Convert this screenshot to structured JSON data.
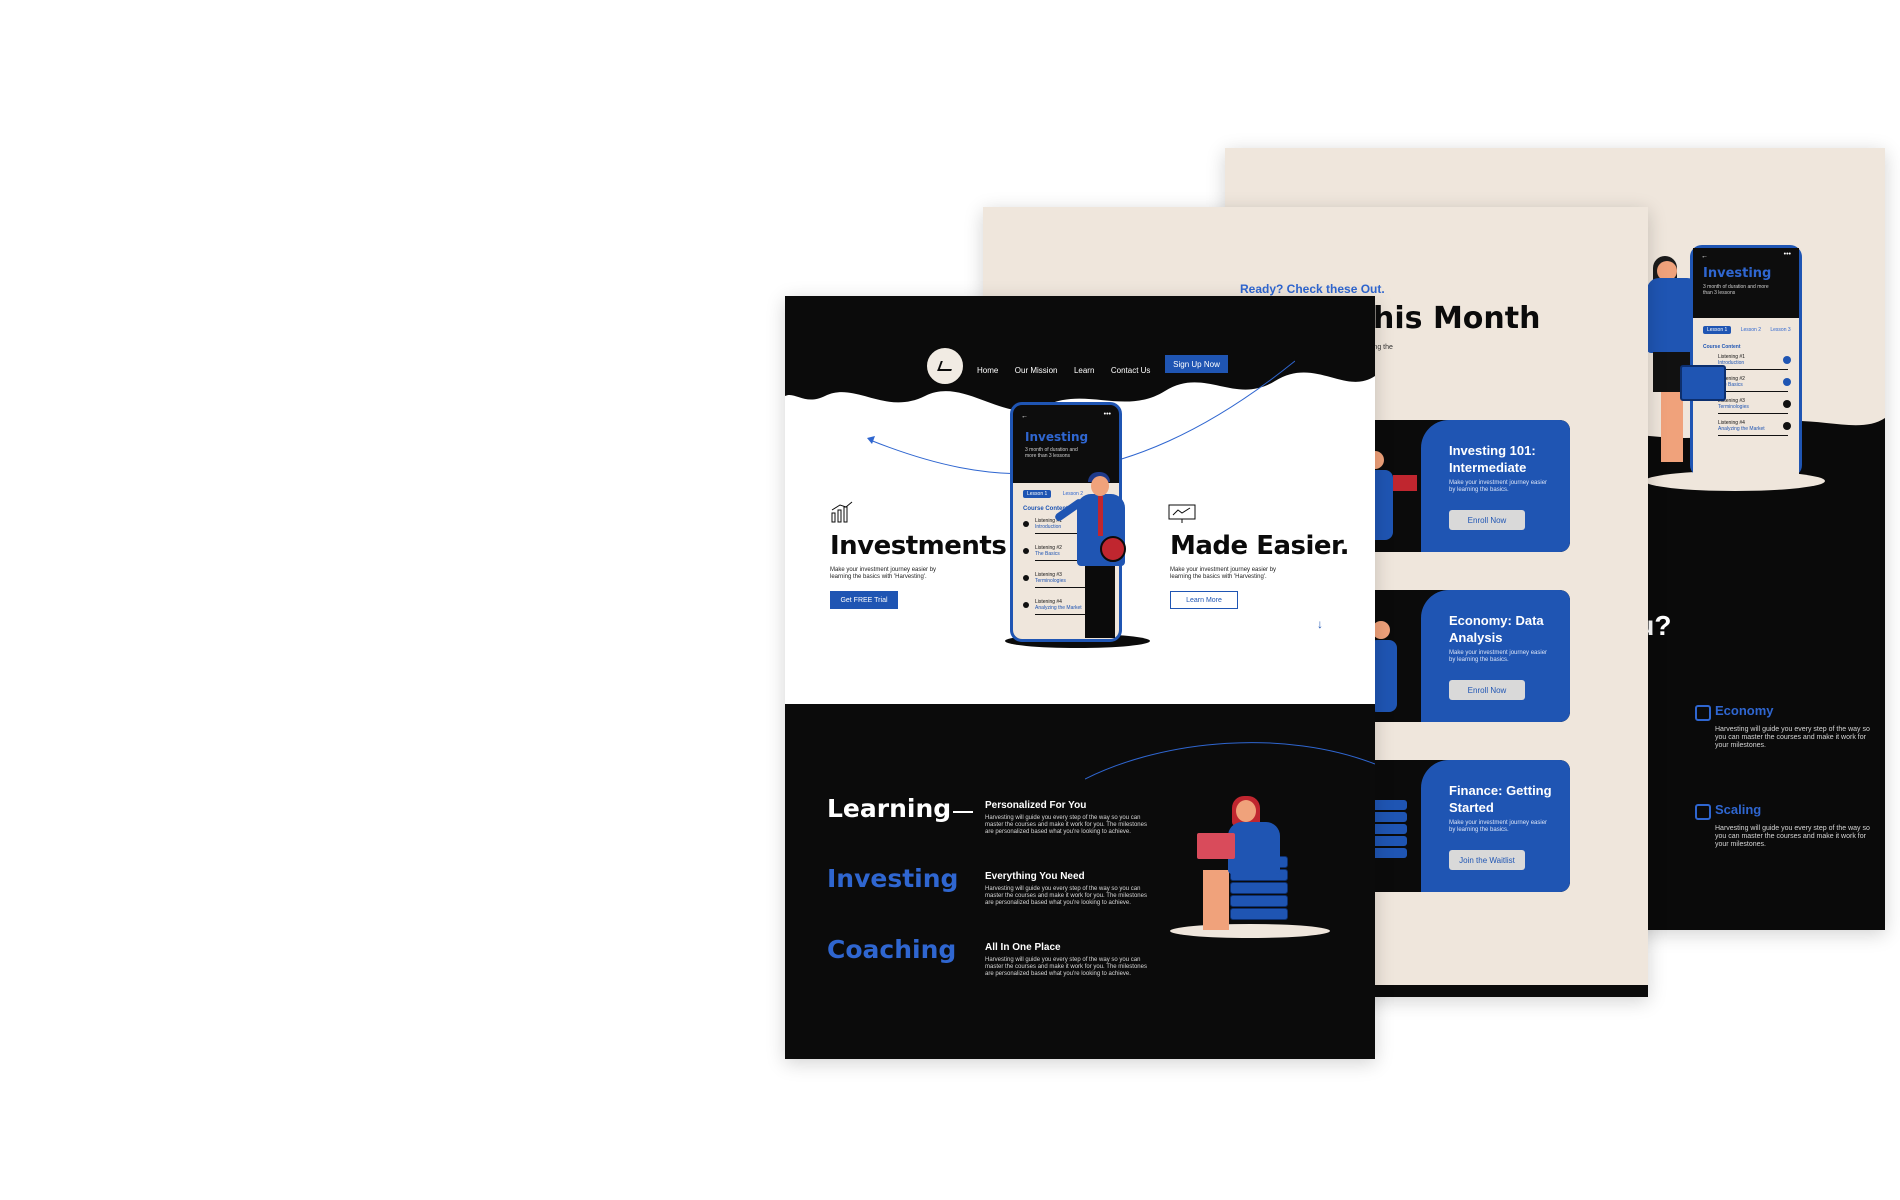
{
  "back_sheet": {
    "phone": {
      "title": "Investing",
      "subtitle": "3 month of duration and more than 3 lessons",
      "tabs": [
        "Lesson 1",
        "Lesson 2",
        "Lesson 3"
      ],
      "course_content": "Course Content",
      "lessons": [
        {
          "title": "Listening #1",
          "sub": "Introduction"
        },
        {
          "title": "Listening #2",
          "sub": "The Basics"
        },
        {
          "title": "Listening #3",
          "sub": "Terminologies"
        },
        {
          "title": "Listening #4",
          "sub": "Analyzing the Market"
        }
      ]
    },
    "heading": "t You?",
    "items": [
      {
        "title": "Economy",
        "text": "Harvesting will guide you every step of the way so you can master the courses and make it work for your milestones."
      },
      {
        "title": "Scaling",
        "text": "Harvesting will guide you every step of the way so you can master the courses and make it work for your milestones."
      }
    ]
  },
  "mid_sheet": {
    "kicker": "Ready? Check these Out.",
    "title": "his Month",
    "subtitle": "ning the",
    "courses": [
      {
        "title": "Investing 101: Intermediate",
        "text": "Make your investment journey easier by learning the basics.",
        "button": "Enroll Now"
      },
      {
        "title": "Economy: Data Analysis",
        "text": "Make your investment journey easier by learning the basics.",
        "button": "Enroll Now"
      },
      {
        "title": "Finance: Getting Started",
        "text": "Make your investment journey easier by learning the basics.",
        "button": "Join the Waitlist"
      }
    ]
  },
  "front_sheet": {
    "nav": [
      "Home",
      "Our Mission",
      "Learn",
      "Contact Us"
    ],
    "signup": "Sign Up Now",
    "phone": {
      "title": "Investing",
      "subtitle": "3 month of duration and more than 3 lessons",
      "tabs": [
        "Lesson 1",
        "Lesson 2"
      ],
      "course_content": "Course Content",
      "lessons": [
        {
          "title": "Listening #1",
          "sub": "Introduction"
        },
        {
          "title": "Listening #2",
          "sub": "The Basics"
        },
        {
          "title": "Listening #3",
          "sub": "Terminologies"
        },
        {
          "title": "Listening #4",
          "sub": "Analyzing the Market"
        }
      ]
    },
    "hero_left": {
      "heading": "Investments",
      "text": "Make your investment journey easier by learning the basics with 'Harvesting'.",
      "button": "Get FREE Trial"
    },
    "hero_right": {
      "heading": "Made Easier.",
      "text": "Make your investment journey easier by learning the basics with 'Harvesting'.",
      "button": "Learn More"
    },
    "scroll_arrow": "↓",
    "pillars": [
      "Learning",
      "Investing",
      "Coaching"
    ],
    "features": [
      {
        "title": "Personalized For You",
        "text": "Harvesting will guide you every step of the way so you can master the courses and make it work for you. The milestones are personalized based what you're looking to achieve."
      },
      {
        "title": "Everything You Need",
        "text": "Harvesting will guide you every step of the way so you can master the courses and make it work for you. The milestones are personalized based what you're looking to achieve."
      },
      {
        "title": "All In One Place",
        "text": "Harvesting will guide you every step of the way so you can master the courses and make it work for you. The milestones are personalized based what you're looking to achieve."
      }
    ]
  },
  "colors": {
    "brand_blue": "#1f55b3",
    "accent_blue": "#2f66d0",
    "cream": "#efe6dc",
    "black": "#0b0b0b",
    "red": "#c0262f"
  }
}
